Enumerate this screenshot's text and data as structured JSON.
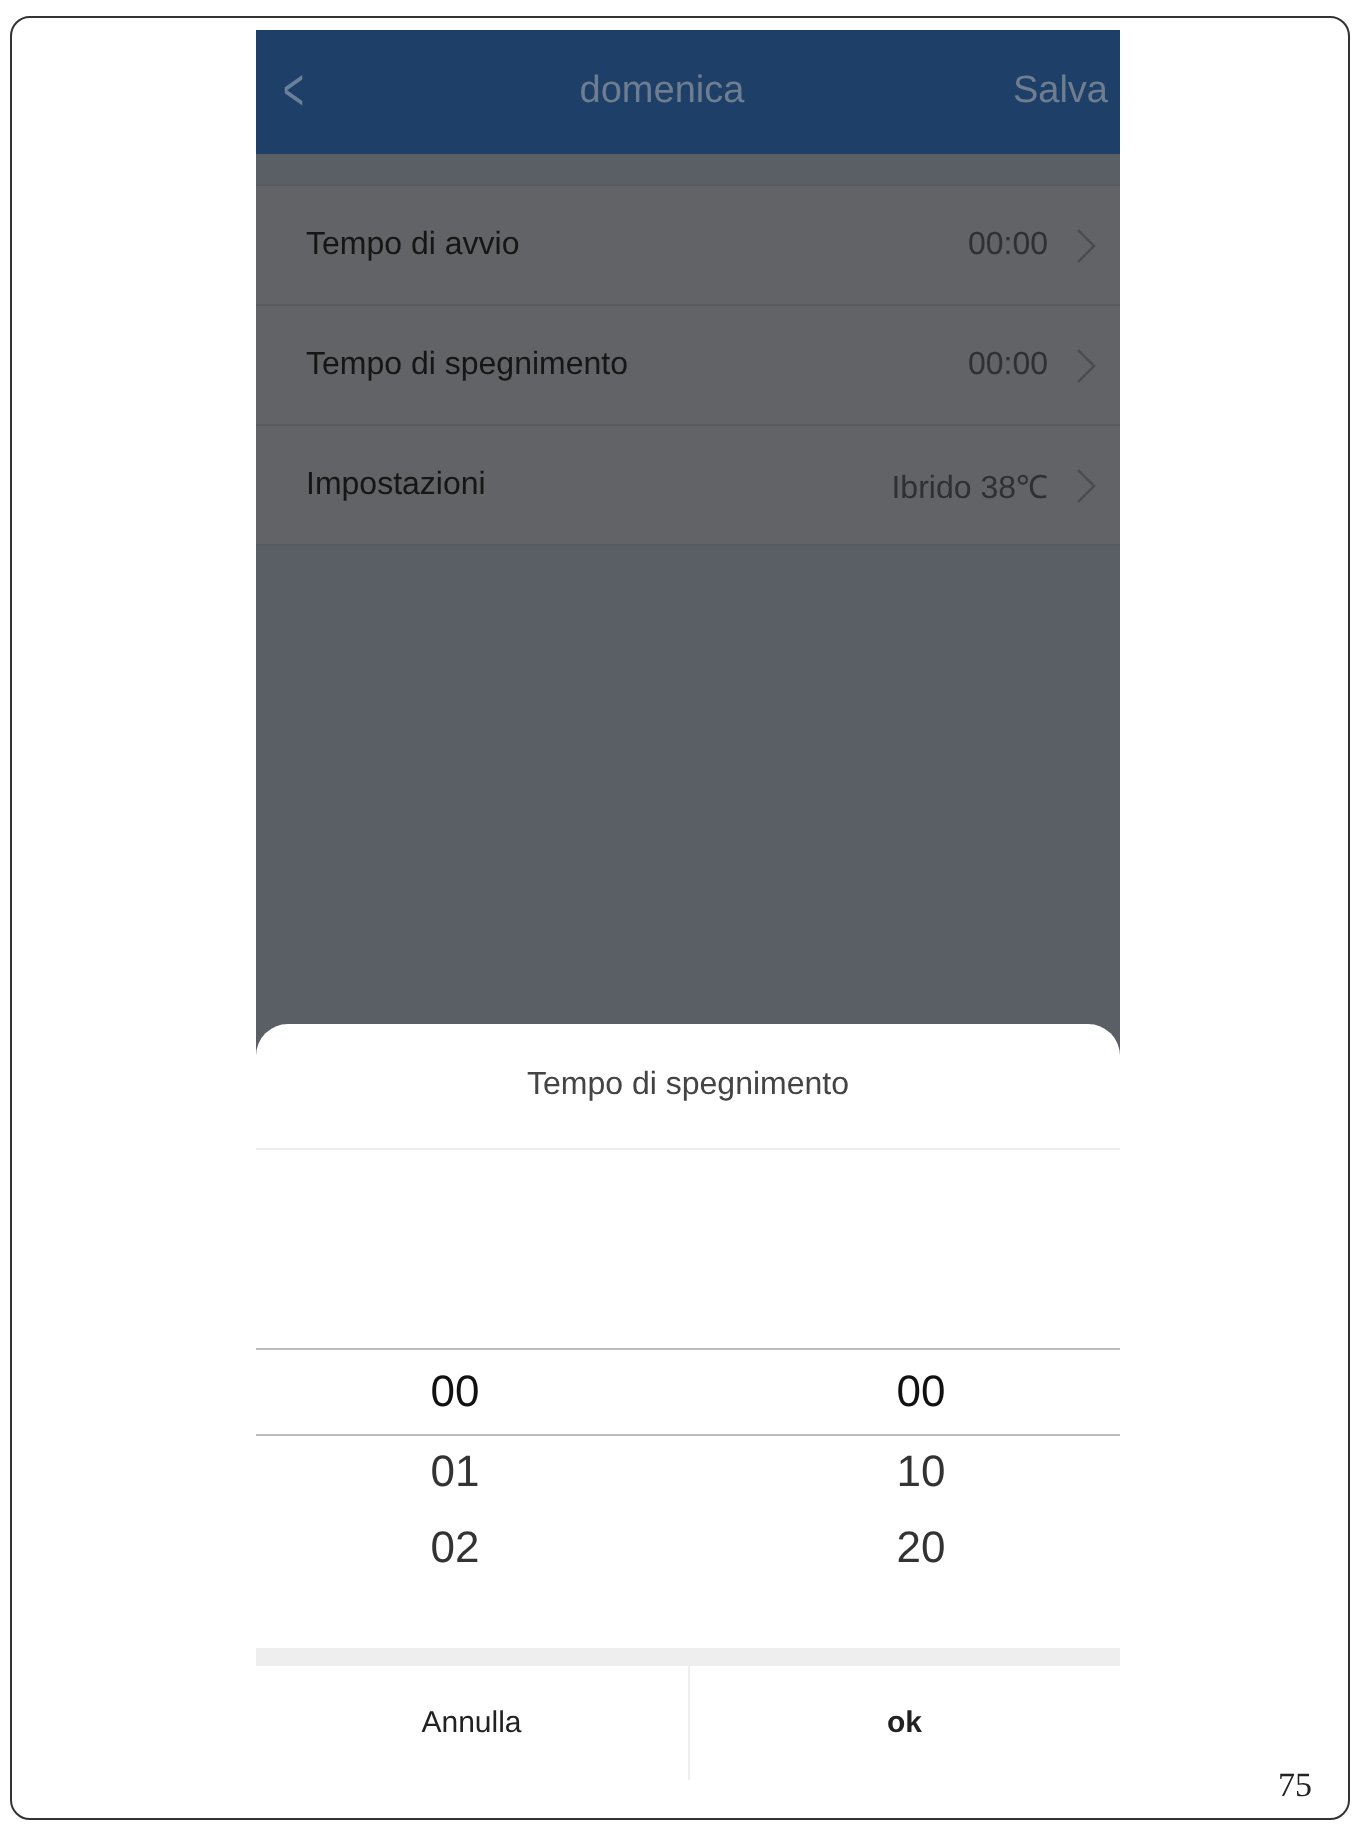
{
  "header": {
    "back": "<",
    "title": "domenica",
    "save": "Salva"
  },
  "rows": [
    {
      "label": "Tempo di avvio",
      "value": "00:00"
    },
    {
      "label": "Tempo di spegnimento",
      "value": "00:00"
    },
    {
      "label": "Impostazioni",
      "value": "Ibrido 38℃"
    }
  ],
  "sheet": {
    "title": "Tempo di spegnimento",
    "columns": [
      {
        "items": [
          {
            "text": "00",
            "selected": true
          },
          {
            "text": "01",
            "selected": false
          },
          {
            "text": "02",
            "selected": false
          }
        ]
      },
      {
        "items": [
          {
            "text": "00",
            "selected": true
          },
          {
            "text": "10",
            "selected": false
          },
          {
            "text": "20",
            "selected": false
          }
        ]
      }
    ],
    "buttons": [
      {
        "label": "Annulla",
        "kind": "cancel"
      },
      {
        "label": "ok",
        "kind": "confirm"
      }
    ]
  },
  "page_number": "75"
}
